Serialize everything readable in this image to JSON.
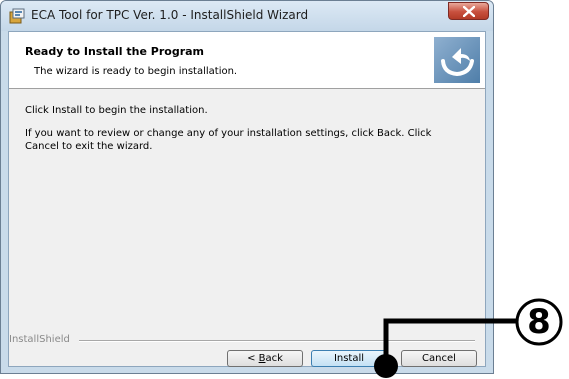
{
  "window": {
    "title": "ECA Tool for TPC Ver. 1.0 - InstallShield Wizard",
    "close_icon": "close-x-icon"
  },
  "header": {
    "title": "Ready to Install the Program",
    "subtitle": "The wizard is ready to begin installation.",
    "logo_icon": "installshield-logo-icon"
  },
  "body": {
    "line1": "Click Install to begin the installation.",
    "line2": "If you want to review or change any of your installation settings, click Back. Click Cancel to exit the wizard."
  },
  "footer": {
    "brand": "InstallShield",
    "back_accel": "B",
    "back_rest": "ack",
    "back_prefix": "< ",
    "install_label": "Install",
    "cancel_label": "Cancel"
  },
  "callout": {
    "number": "8"
  },
  "colors": {
    "title_bar": "#c4d7e8",
    "client_bg": "#f0f0f0",
    "close_red": "#c8503e",
    "logo_blue": "#5a88b4"
  }
}
